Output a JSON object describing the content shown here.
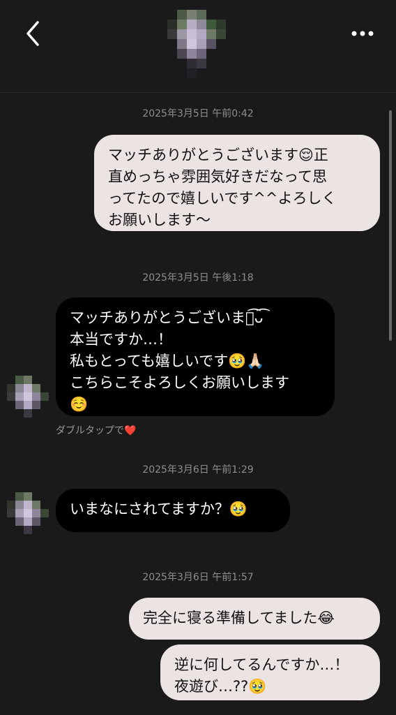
{
  "header": {
    "back_icon": "chevron-left-icon",
    "more_icon": "more-horizontal-icon",
    "avatar": "pixelated-avatar"
  },
  "messages": [
    {
      "type": "timestamp",
      "text": "2025年3月5日 午前0:42"
    },
    {
      "type": "outgoing",
      "text": "マッチありがとうございます😌正\n直めっちゃ雰囲気好きだなって思\nってたので嬉しいです^^よろしく\nお願いします〜"
    },
    {
      "type": "timestamp",
      "text": "2025年3月5日 午後1:18"
    },
    {
      "type": "incoming",
      "text": "マッチありがとうございます͡ᴗ͡\n本当ですか…！\n私もとっても嬉しいです🥹🙏🏻\nこちらこそよろしくお願いします\n☺️"
    },
    {
      "type": "hint",
      "text": "ダブルタップで",
      "icon": "❤️"
    },
    {
      "type": "timestamp",
      "text": "2025年3月6日 午前1:29"
    },
    {
      "type": "incoming",
      "text": "いまなにされてますか？🥹"
    },
    {
      "type": "timestamp",
      "text": "2025年3月6日 午前1:57"
    },
    {
      "type": "outgoing",
      "text": "完全に寝る準備してました😂"
    },
    {
      "type": "outgoing",
      "text": "逆に何してるんですか…！\n夜遊び…??🥹"
    }
  ],
  "colors": {
    "background": "#1a1a1a",
    "outgoing_bubble": "#ece3e3",
    "incoming_bubble": "#000000",
    "timestamp": "#8e8e8e"
  }
}
